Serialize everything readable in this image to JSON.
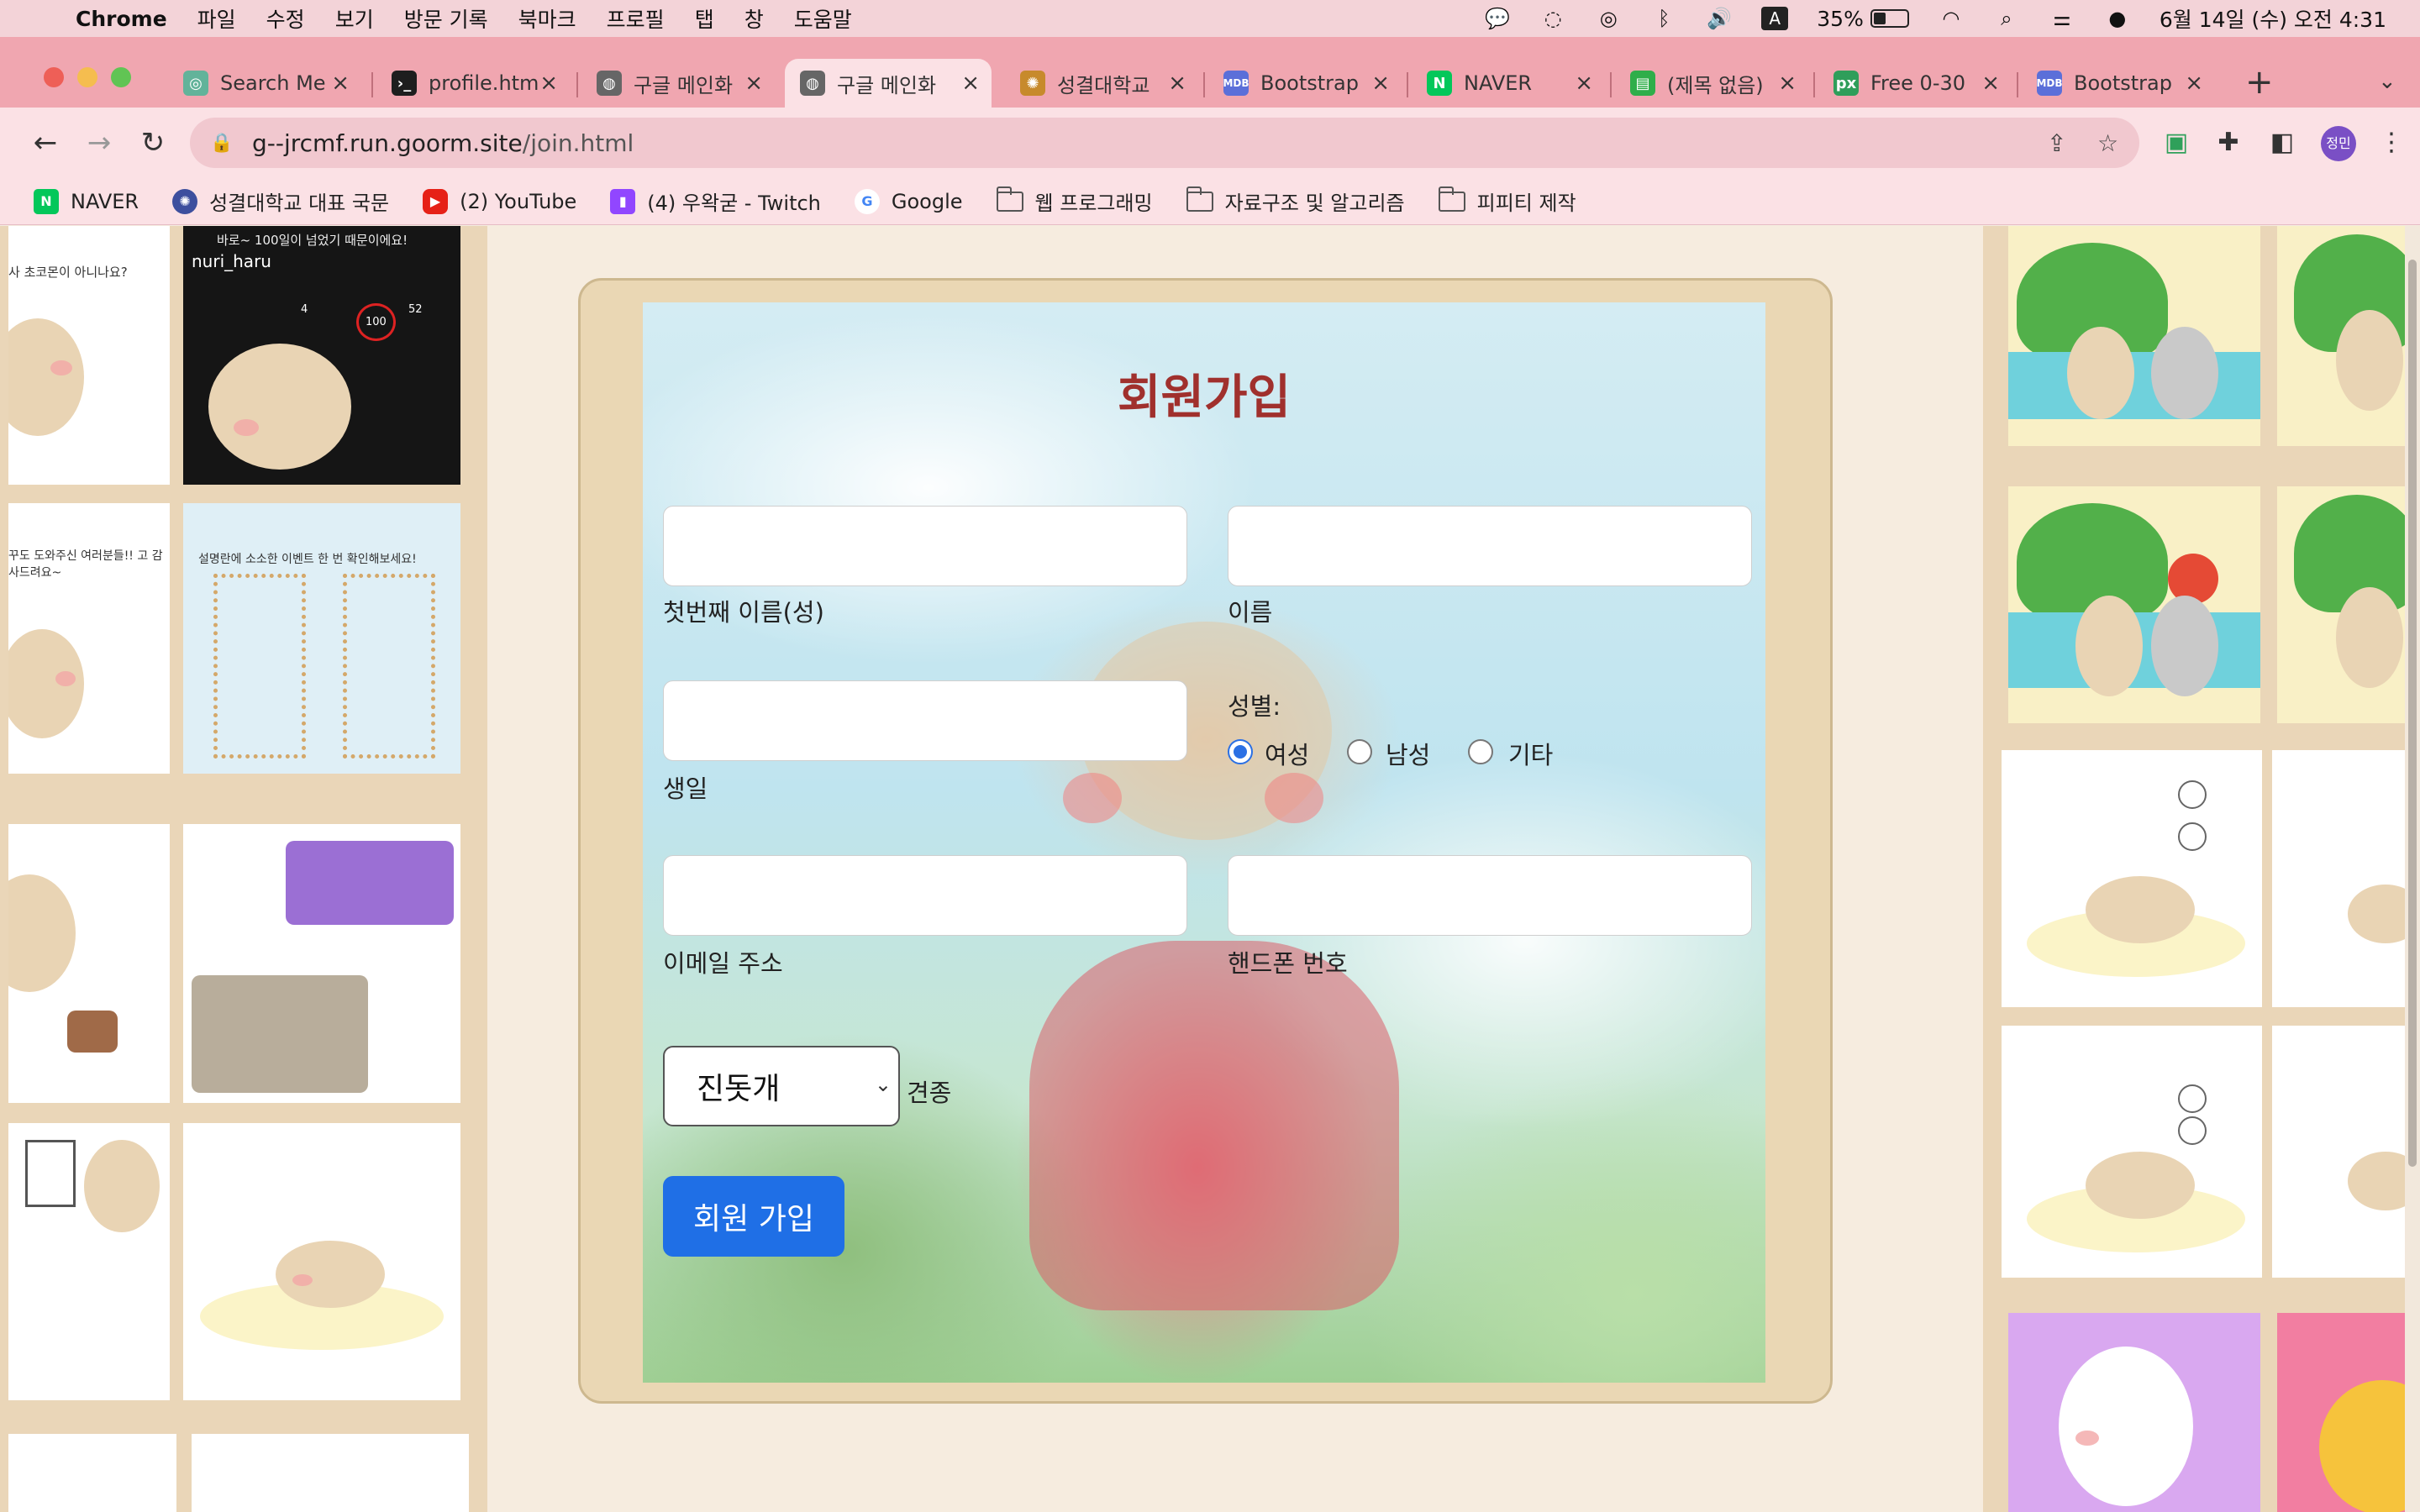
{
  "menubar": {
    "app_name": "Chrome",
    "items": [
      "파일",
      "수정",
      "보기",
      "방문 기록",
      "북마크",
      "프로필",
      "탭",
      "창",
      "도움말"
    ],
    "battery": "35%",
    "datetime": "6월 14일 (수) 오전 4:31",
    "input_indicator": "A"
  },
  "tabs": [
    {
      "title": "Search Me",
      "icon": "search-favicon"
    },
    {
      "title": "profile.htm",
      "icon": "terminal-icon"
    },
    {
      "title": "구글 메인화",
      "icon": "globe-icon"
    },
    {
      "title": "구글 메인화",
      "icon": "globe-icon",
      "active": true
    },
    {
      "title": "성결대학교",
      "icon": "university-icon"
    },
    {
      "title": "Bootstrap",
      "icon": "mdb-icon"
    },
    {
      "title": "NAVER",
      "icon": "naver-icon"
    },
    {
      "title": "(제목 없음)",
      "icon": "doc-icon"
    },
    {
      "title": "Free 0-30",
      "icon": "px-icon"
    },
    {
      "title": "Bootstrap",
      "icon": "mdb-icon"
    }
  ],
  "address": {
    "host": "g--jrcmf.run.goorm.site",
    "path": "/join.html"
  },
  "profile": {
    "initials": "정민"
  },
  "bookmarks": [
    {
      "label": "NAVER",
      "icon": "naver-icon"
    },
    {
      "label": "성결대학교 대표 국문",
      "icon": "university-icon"
    },
    {
      "label": "(2) YouTube",
      "icon": "youtube-icon"
    },
    {
      "label": "(4) 우왁굳 - Twitch",
      "icon": "twitch-icon"
    },
    {
      "label": "Google",
      "icon": "google-icon"
    },
    {
      "label": "웹 프로그래밍",
      "icon": "folder-icon"
    },
    {
      "label": "자료구조 및 알고리즘",
      "icon": "folder-icon"
    },
    {
      "label": "피피티 제작",
      "icon": "folder-icon"
    }
  ],
  "gallery_text": {
    "thumb1_caption": "사 초코몬이 아니나요?",
    "thumb2_header": "바로~ 100일이 넘었기 때문이에요!",
    "thumb2_username": "nuri_haru",
    "thumb2_stats": [
      "4",
      "100",
      "52"
    ],
    "thumb3_caption": "꾸도 도와주신 여러분들!! 고 감사드려요~",
    "thumb4_caption": "설명란에 소소한 이벤트 한 번 확인해보세요!"
  },
  "form": {
    "title": "회원가입",
    "last_name_label": "첫번째 이름(성)",
    "first_name_label": "이름",
    "birthday_label": "생일",
    "gender_label": "성별:",
    "gender_options": [
      "여성",
      "남성",
      "기타"
    ],
    "gender_selected": "여성",
    "email_label": "이메일 주소",
    "phone_label": "핸드폰 번호",
    "breed_value": "진돗개",
    "breed_label": "견종",
    "submit_label": "회원 가입"
  },
  "colors": {
    "menubar": "#f3d3d8",
    "tabstrip": "#f0a6b0",
    "title": "#a0302d",
    "primary_button": "#1f6fe6",
    "card": "#ead7b4"
  }
}
